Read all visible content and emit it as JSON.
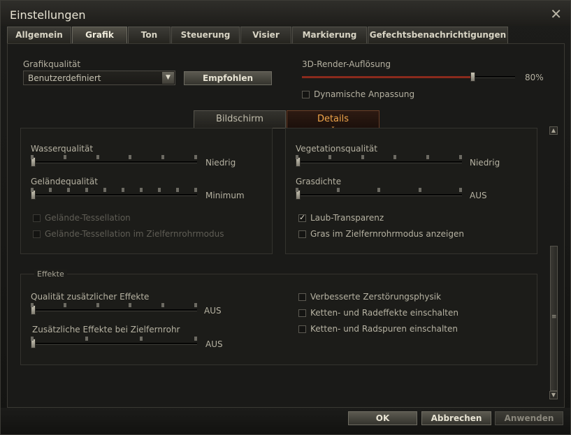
{
  "window": {
    "title": "Einstellungen"
  },
  "tabs": [
    {
      "label": "Allgemein"
    },
    {
      "label": "Grafik"
    },
    {
      "label": "Ton"
    },
    {
      "label": "Steuerung"
    },
    {
      "label": "Visier"
    },
    {
      "label": "Markierung"
    },
    {
      "label": "Gefechtsbenachrichtigungen"
    }
  ],
  "active_tab": "Grafik",
  "graphics": {
    "quality_label": "Grafikqualität",
    "quality_value": "Benutzerdefiniert",
    "recommended_button": "Empfohlen",
    "render_label": "3D-Render-Auflösung",
    "render_value_text": "80%",
    "render_value": 0.8,
    "dynamic_label": "Dynamische Anpassung",
    "dynamic_checked": false
  },
  "subtabs": [
    {
      "label": "Bildschirm"
    },
    {
      "label": "Details"
    }
  ],
  "active_subtab": "Details",
  "details": {
    "water_label": "Wasserqualität",
    "water_value": "Niedrig",
    "terrain_label": "Geländequalität",
    "terrain_value": "Minimum",
    "tess_label": "Gelände-Tessellation",
    "tess_scope_label": "Gelände-Tessellation im Zielfernrohrmodus",
    "vegetation_label": "Vegetationsqualität",
    "vegetation_value": "Niedrig",
    "grass_label": "Grasdichte",
    "grass_value": "AUS",
    "foliage_label": "Laub-Transparenz",
    "foliage_checked": true,
    "grass_scope_label": "Gras im Zielfernrohrmodus anzeigen",
    "grass_scope_checked": false
  },
  "effects": {
    "legend": "Effekte",
    "extra_label": "Qualität zusätzlicher Effekte",
    "extra_value": "AUS",
    "scope_label": "Zusätzliche Effekte bei Zielfernrohr",
    "scope_value": "AUS",
    "destruction_label": "Verbesserte Zerstörungsphysik",
    "track_effects_label": "Ketten- und Radeffekte einschalten",
    "track_marks_label": "Ketten- und Radspuren einschalten"
  },
  "footer": {
    "ok": "OK",
    "cancel": "Abbrechen",
    "apply": "Anwenden"
  },
  "colors": {
    "accent": "#f1a64a",
    "slider_fill": "#8a2a1c"
  }
}
